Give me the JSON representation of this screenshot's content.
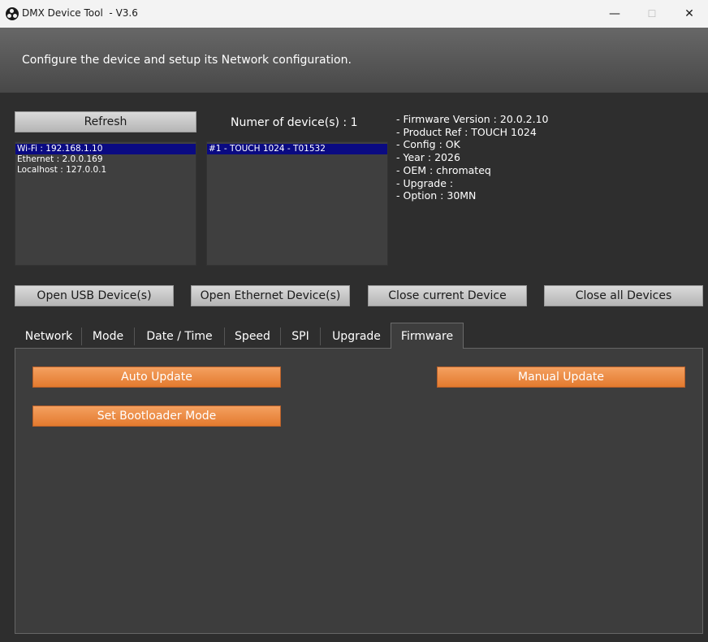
{
  "window": {
    "title": "DMX Device Tool  - V3.6",
    "minimize_glyph": "—",
    "maximize_glyph": "☐",
    "close_glyph": "✕"
  },
  "header": {
    "text": "Configure the device and setup its Network configuration."
  },
  "refresh_label": "Refresh",
  "interfaces": [
    "Wi-Fi : 192.168.1.10",
    "Ethernet : 2.0.0.169",
    "Localhost : 127.0.0.1"
  ],
  "device_count_label": "Numer of device(s) : 1",
  "devices": [
    "#1 - TOUCH 1024 - T01532"
  ],
  "device_info": [
    "- Firmware Version : 20.0.2.10",
    "- Product Ref : TOUCH 1024",
    "- Config : OK",
    "- Year : 2026",
    "- OEM : chromateq",
    "- Upgrade :",
    "- Option : 30MN"
  ],
  "actions": {
    "open_usb": "Open USB Device(s)",
    "open_ethernet": "Open Ethernet Device(s)",
    "close_current": "Close current Device",
    "close_all": "Close all Devices"
  },
  "tabs": [
    "Network",
    "Mode",
    "Date / Time",
    "Speed",
    "SPI",
    "Upgrade",
    "Firmware"
  ],
  "active_tab": "Firmware",
  "firmware": {
    "auto_update": "Auto Update",
    "manual_update": "Manual Update",
    "bootloader": "Set Bootloader Mode"
  },
  "colors": {
    "accent_orange": "#e8843a",
    "selection": "#0a0a82",
    "background": "#2e2e2e"
  }
}
